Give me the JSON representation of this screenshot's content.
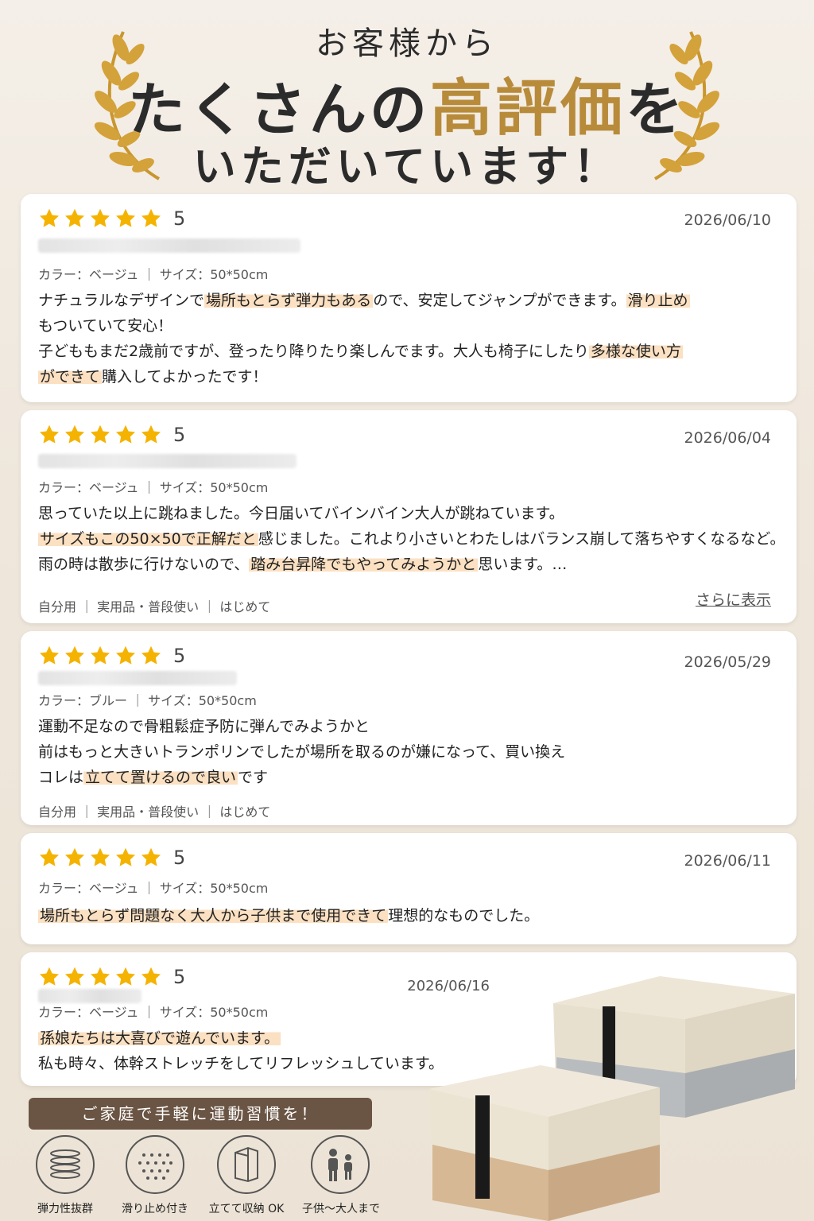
{
  "header": {
    "line1": "お客様から",
    "line2_pre": "たくさんの",
    "line2_accent": "高評価",
    "line2_post": "を",
    "line3": "いただいています！"
  },
  "reviews": [
    {
      "rating": 5,
      "date": "2026/06/10",
      "meta": "カラー：ベージュ ｜ サイズ：50*50cm",
      "body": [
        [
          {
            "t": "ナチュラルなデザインで"
          },
          {
            "t": "場所もとらず弾力もある",
            "hl": true
          },
          {
            "t": "ので、安定してジャンプができます。"
          },
          {
            "t": "滑り止め",
            "hl": true
          }
        ],
        [
          {
            "t": "もついていて安心！"
          }
        ],
        [
          {
            "t": "子どももまだ2歳前ですが、登ったり降りたり楽しんでます。大人も椅子にしたり"
          },
          {
            "t": "多様な使い方",
            "hl": true
          }
        ],
        [
          {
            "t": "ができて",
            "hl": true
          },
          {
            "t": "購入してよかったです！"
          }
        ]
      ]
    },
    {
      "rating": 5,
      "date": "2026/06/04",
      "meta": "カラー：ベージュ ｜ サイズ：50*50cm",
      "body": [
        [
          {
            "t": "思っていた以上に跳ねました。今日届いてバインバイン大人が跳ねています。"
          }
        ],
        [
          {
            "t": "サイズもこの50×50で正解だと",
            "hl": true
          },
          {
            "t": "感じました。これより小さいとわたしはバランス崩して落ちやすくなるなど。"
          }
        ],
        [
          {
            "t": "雨の時は散歩に行けないので、"
          },
          {
            "t": "踏み台昇降でもやってみようかと",
            "hl": true
          },
          {
            "t": "思います。…"
          }
        ]
      ],
      "tags": "自分用 ｜ 実用品・普段使い ｜ はじめて",
      "more": "さらに表示"
    },
    {
      "rating": 5,
      "date": "2026/05/29",
      "meta": "カラー：ブルー ｜ サイズ：50*50cm",
      "body": [
        [
          {
            "t": "運動不足なので骨粗鬆症予防に弾んでみようかと"
          }
        ],
        [
          {
            "t": "前はもっと大きいトランポリンでしたが場所を取るのが嫌になって、買い換え"
          }
        ],
        [
          {
            "t": "コレは"
          },
          {
            "t": "立てて置けるので良い",
            "hl": true
          },
          {
            "t": "です"
          }
        ]
      ],
      "tags": "自分用 ｜ 実用品・普段使い ｜ はじめて"
    },
    {
      "rating": 5,
      "date": "2026/06/11",
      "meta": "カラー：ベージュ ｜ サイズ：50*50cm",
      "body": [
        [
          {
            "t": "場所もとらず問題なく大人から子供まで使用できて",
            "hl": true
          },
          {
            "t": "理想的なものでした。"
          }
        ]
      ]
    },
    {
      "rating": 5,
      "date": "2026/06/16",
      "meta": "カラー：ベージュ ｜ サイズ：50*50cm",
      "body": [
        [
          {
            "t": "孫娘たちは大喜びで遊んでいます。",
            "hl": true
          }
        ],
        [
          {
            "t": "私も時々、体幹ストレッチをしてリフレッシュしています。"
          }
        ]
      ]
    }
  ],
  "banner": "ご家庭で手軽に運動習慣を！",
  "features": [
    {
      "label": "弾力性抜群",
      "icon": "spring-icon"
    },
    {
      "label": "滑り止め付き",
      "icon": "non-slip-dots-icon"
    },
    {
      "label": "立てて収納 OK",
      "icon": "upright-storage-icon"
    },
    {
      "label": "子供〜大人まで",
      "icon": "family-icon"
    }
  ],
  "colors": {
    "accent": "#b88b3a",
    "highlight": "#fbe0c2",
    "banner": "#6a5443",
    "star": "#f5b301"
  }
}
